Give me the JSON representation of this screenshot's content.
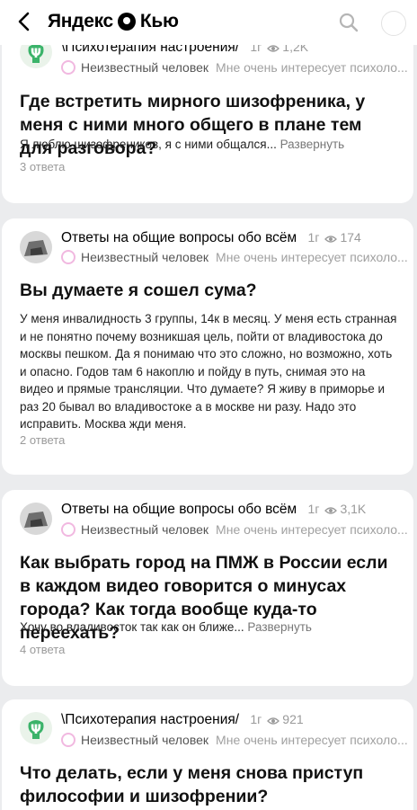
{
  "header": {
    "logo_left": "Яндекс",
    "logo_right": "Кью"
  },
  "cards": [
    {
      "channel": "\\Психотерапия настроения/",
      "age": "1г",
      "views": "1,2K",
      "author": "Неизвестный человек",
      "tagline": "Мне очень интересует психоло...",
      "title": "Где встретить мирного шизофреника, у меня с ними много общего в плане тем для разговора?",
      "text": "Я люблю шизофреников, я с ними общался...",
      "expand": "Развернуть",
      "answers": "3 ответа"
    },
    {
      "channel": "Ответы на общие вопросы обо всём",
      "age": "1г",
      "views": "174",
      "author": "Неизвестный человек",
      "tagline": "Мне очень интересует психоло...",
      "title": "Вы думаете я сошел сума?",
      "text": "У меня инвалидность 3 группы, 14к в месяц. У меня есть странная и не понятно почему возникшая цель, пойти от владивостока до москвы пешком. Да я понимаю что это сложно, но возможно, хоть и опасно. Годов там 6 накоплю и пойду в путь, снимая это на видео и прямые трансляции. Что думаете? Я живу в приморье и раз 20 бывал во владивостоке а в москве ни разу. Надо это исправить. Москва жди меня.",
      "answers": "2 ответа"
    },
    {
      "channel": "Ответы на общие вопросы обо всём",
      "age": "1г",
      "views": "3,1K",
      "author": "Неизвестный человек",
      "tagline": "Мне очень интересует психоло...",
      "title": "Как выбрать город на ПМЖ в России если в каждом видео говорится о минусах города? Как тогда вообще куда-то переехать?",
      "text": "Хочу во владивосток так как он ближе...",
      "expand": "Развернуть",
      "answers": "4 ответа"
    },
    {
      "channel": "\\Психотерапия настроения/",
      "age": "1г",
      "views": "921",
      "author": "Неизвестный человек",
      "tagline": "Мне очень интересует психоло...",
      "title": "Что делать, если у меня снова приступ философии и шизофрении?"
    }
  ]
}
